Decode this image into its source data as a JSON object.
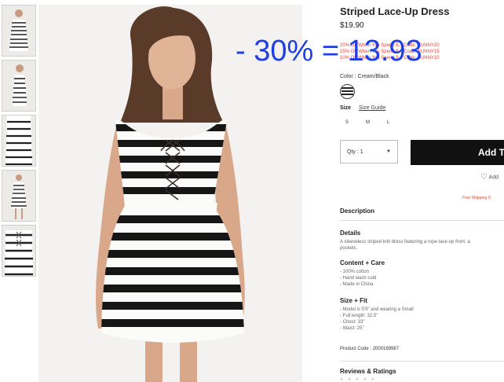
{
  "product": {
    "title": "Striped Lace-Up Dress",
    "price": "$19.90",
    "promo_lines": [
      "20% Off When You Spend $... Code: SUNNY20",
      "15% Off When You Spend $... Code: SUNNY15",
      "10% Off When You Spend $... Code: SUNNY10"
    ],
    "color_label": "Color : Cream/Black",
    "size_label": "Size",
    "size_guide": "Size Guide",
    "sizes": [
      "S",
      "M",
      "L"
    ],
    "qty_label": "Qty : 1",
    "add_button": "Add T",
    "wishlist": "Add",
    "shipping": "Free Shipping O"
  },
  "overlay": {
    "discount_text": "- 30% = 13.93"
  },
  "description": {
    "heading": "Description",
    "details_heading": "Details",
    "details_lines": [
      "A sleeveless striped knit dress featuring a rope lace-up front, a",
      "pockets."
    ],
    "content_heading": "Content + Care",
    "content_lines": [
      "- 100% cotton",
      "- Hand wash cold",
      "- Made in China"
    ],
    "fit_heading": "Size + Fit",
    "fit_lines": [
      "- Model is 5'9\" and wearing a Small",
      "- Full length: 32.5\"",
      "- Chest: 33\"",
      "- Waist: 25\""
    ],
    "product_code": "Product Code : 2000169987"
  },
  "reviews": {
    "heading": "Reviews & Ratings",
    "stars": "★ ★ ★ ★ ★"
  },
  "colors": {
    "promo_red": "#e0453a",
    "overlay_blue": "#1f3fe6",
    "button_black": "#111111"
  }
}
